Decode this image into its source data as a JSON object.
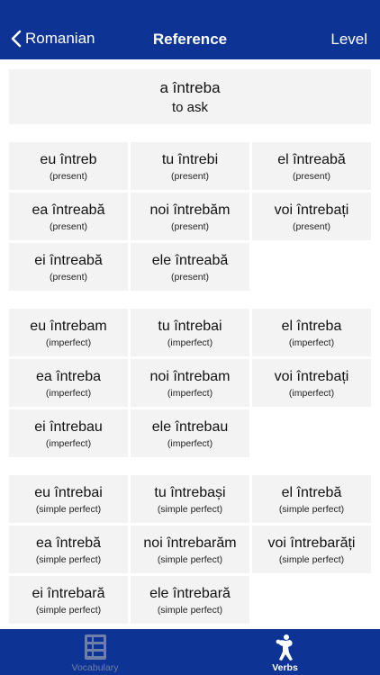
{
  "nav": {
    "back_label": "Romanian",
    "title": "Reference",
    "right_label": "Level"
  },
  "verb": {
    "infinitive": "a întreba",
    "translation": "to ask"
  },
  "groups": [
    {
      "cells": [
        {
          "form": "eu întreb",
          "tense": "(present)"
        },
        {
          "form": "tu întrebi",
          "tense": "(present)"
        },
        {
          "form": "el întreabă",
          "tense": "(present)"
        },
        {
          "form": "ea întreabă",
          "tense": "(present)"
        },
        {
          "form": "noi întrebăm",
          "tense": "(present)"
        },
        {
          "form": "voi întrebați",
          "tense": "(present)"
        },
        {
          "form": "ei întreabă",
          "tense": "(present)"
        },
        {
          "form": "ele întreabă",
          "tense": "(present)"
        }
      ]
    },
    {
      "cells": [
        {
          "form": "eu întrebam",
          "tense": "(imperfect)"
        },
        {
          "form": "tu întrebai",
          "tense": "(imperfect)"
        },
        {
          "form": "el întreba",
          "tense": "(imperfect)"
        },
        {
          "form": "ea întreba",
          "tense": "(imperfect)"
        },
        {
          "form": "noi întrebam",
          "tense": "(imperfect)"
        },
        {
          "form": "voi întrebați",
          "tense": "(imperfect)"
        },
        {
          "form": "ei întrebau",
          "tense": "(imperfect)"
        },
        {
          "form": "ele întrebau",
          "tense": "(imperfect)"
        }
      ]
    },
    {
      "cells": [
        {
          "form": "eu întrebai",
          "tense": "(simple perfect)"
        },
        {
          "form": "tu întrebași",
          "tense": "(simple perfect)"
        },
        {
          "form": "el întrebă",
          "tense": "(simple perfect)"
        },
        {
          "form": "ea întrebă",
          "tense": "(simple perfect)"
        },
        {
          "form": "noi întrebarăm",
          "tense": "(simple perfect)"
        },
        {
          "form": "voi întrebarăți",
          "tense": "(simple perfect)"
        },
        {
          "form": "ei întrebară",
          "tense": "(simple perfect)"
        },
        {
          "form": "ele întrebară",
          "tense": "(simple perfect)"
        }
      ]
    }
  ],
  "tabs": [
    {
      "label": "Vocabulary",
      "icon": "vocabulary-cards-icon",
      "active": false
    },
    {
      "label": "Verbs",
      "icon": "discus-thrower-icon",
      "active": true
    }
  ],
  "colors": {
    "brand": "#0d3494",
    "cell_bg": "#f3f3f3",
    "inactive_tab": "#6f7fa8"
  }
}
